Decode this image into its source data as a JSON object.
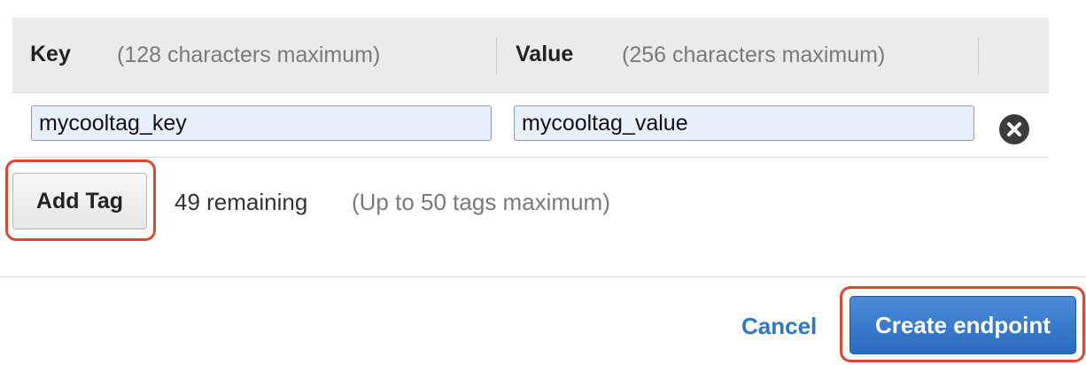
{
  "tags_table": {
    "key_header": "Key",
    "key_hint": "(128 characters maximum)",
    "value_header": "Value",
    "value_hint": "(256 characters maximum)",
    "rows": [
      {
        "key": "mycooltag_key",
        "value": "mycooltag_value"
      }
    ],
    "remove_icon": "close-circle-icon"
  },
  "add_tag": {
    "button_label": "Add Tag",
    "remaining_text": "49 remaining",
    "max_note": "(Up to 50 tags maximum)"
  },
  "footer": {
    "cancel_label": "Cancel",
    "create_label": "Create endpoint"
  },
  "colors": {
    "highlight": "#e3452c",
    "primary_button": "#2f72c4",
    "link": "#2b78c6",
    "input_background": "#e8f0fe"
  }
}
